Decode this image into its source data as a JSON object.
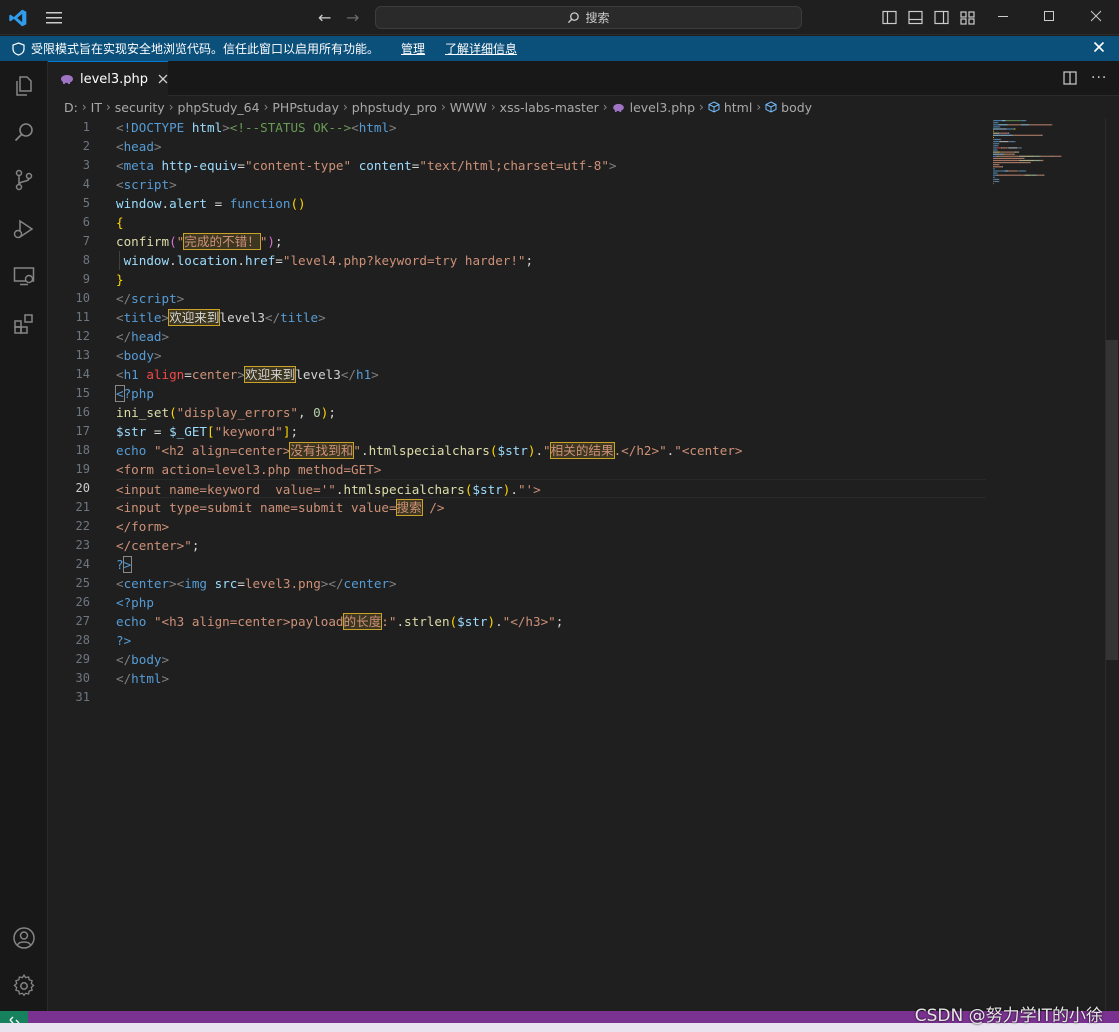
{
  "titlebar": {
    "search_placeholder": "搜索"
  },
  "banner": {
    "message": "受限模式旨在实现安全地浏览代码。信任此窗口以启用所有功能。",
    "manage_link": "管理",
    "learn_more_link": "了解详细信息"
  },
  "activity_bar": {
    "icons": [
      "explorer-icon",
      "search-icon",
      "source-control-icon",
      "run-debug-icon",
      "remote-explorer-icon",
      "extensions-icon",
      "accounts-icon",
      "settings-gear-icon"
    ]
  },
  "tabs": [
    {
      "label": "level3.php",
      "active": true
    }
  ],
  "breadcrumb": [
    "D:",
    "IT",
    "security",
    "phpStudy_64",
    "PHPstuday",
    "phpstudy_pro",
    "WWW",
    "xss-labs-master",
    "level3.php",
    "html",
    "body"
  ],
  "editor": {
    "active_line": 20,
    "line_numbers": [
      "1",
      "2",
      "3",
      "4",
      "5",
      "6",
      "7",
      "8",
      "9",
      "10",
      "11",
      "12",
      "13",
      "14",
      "15",
      "16",
      "17",
      "18",
      "19",
      "20",
      "21",
      "22",
      "23",
      "24",
      "25",
      "26",
      "27",
      "28",
      "29",
      "30",
      "31"
    ],
    "lines": [
      [
        [
          "t-punc",
          "<"
        ],
        [
          "t-tag",
          "!DOCTYPE "
        ],
        [
          "t-attr",
          "html"
        ],
        [
          "t-punc",
          ">"
        ],
        [
          "t-com",
          "<!--STATUS OK-->"
        ],
        [
          "t-punc",
          "<"
        ],
        [
          "t-tag",
          "html"
        ],
        [
          "t-punc",
          ">"
        ]
      ],
      [
        [
          "t-punc",
          "<"
        ],
        [
          "t-tag",
          "head"
        ],
        [
          "t-punc",
          ">"
        ]
      ],
      [
        [
          "t-punc",
          "<"
        ],
        [
          "t-tag",
          "meta "
        ],
        [
          "t-attr",
          "http-equiv"
        ],
        [
          "t-plain",
          "="
        ],
        [
          "t-str",
          "\"content-type\""
        ],
        [
          "t-plain",
          " "
        ],
        [
          "t-attr",
          "content"
        ],
        [
          "t-plain",
          "="
        ],
        [
          "t-str",
          "\"text/html;charset=utf-8\""
        ],
        [
          "t-punc",
          ">"
        ]
      ],
      [
        [
          "t-punc",
          "<"
        ],
        [
          "t-tag",
          "script"
        ],
        [
          "t-punc",
          ">"
        ]
      ],
      [
        [
          "t-var",
          "window"
        ],
        [
          "t-plain",
          "."
        ],
        [
          "t-var",
          "alert"
        ],
        [
          "t-plain",
          " = "
        ],
        [
          "t-key",
          "function"
        ],
        [
          "t-br1",
          "()"
        ]
      ],
      [
        [
          "t-br1",
          "{"
        ]
      ],
      [
        [
          "t-fn",
          "confirm"
        ],
        [
          "t-br2",
          "("
        ],
        [
          "t-str",
          "\""
        ],
        [
          "t-str hl",
          "完成的不错！"
        ],
        [
          "t-str",
          "\""
        ],
        [
          "t-br2",
          ")"
        ],
        [
          "t-plain",
          ";"
        ]
      ],
      [
        [
          "t-plain",
          " "
        ],
        [
          "t-var",
          "window"
        ],
        [
          "t-plain",
          "."
        ],
        [
          "t-var",
          "location"
        ],
        [
          "t-plain",
          "."
        ],
        [
          "t-var",
          "href"
        ],
        [
          "t-plain",
          "="
        ],
        [
          "t-str",
          "\"level4.php?keyword=try harder!\""
        ],
        [
          "t-plain",
          ";"
        ]
      ],
      [
        [
          "t-br1",
          "}"
        ]
      ],
      [
        [
          "t-punc",
          "</"
        ],
        [
          "t-tag",
          "script"
        ],
        [
          "t-punc",
          ">"
        ]
      ],
      [
        [
          "t-punc",
          "<"
        ],
        [
          "t-tag",
          "title"
        ],
        [
          "t-punc",
          ">"
        ],
        [
          "t-plain hl",
          "欢迎来到"
        ],
        [
          "t-plain",
          "level3"
        ],
        [
          "t-punc",
          "</"
        ],
        [
          "t-tag",
          "title"
        ],
        [
          "t-punc",
          ">"
        ]
      ],
      [
        [
          "t-punc",
          "</"
        ],
        [
          "t-tag",
          "head"
        ],
        [
          "t-punc",
          ">"
        ]
      ],
      [
        [
          "t-punc",
          "<"
        ],
        [
          "t-tag",
          "body"
        ],
        [
          "t-punc",
          ">"
        ]
      ],
      [
        [
          "t-punc",
          "<"
        ],
        [
          "t-tag",
          "h1 "
        ],
        [
          "t-red",
          "align"
        ],
        [
          "t-plain",
          "="
        ],
        [
          "t-str",
          "center"
        ],
        [
          "t-punc",
          ">"
        ],
        [
          "t-plain hl",
          "欢迎来到"
        ],
        [
          "t-plain",
          "level3"
        ],
        [
          "t-punc",
          "</"
        ],
        [
          "t-tag",
          "h1"
        ],
        [
          "t-punc",
          ">"
        ]
      ],
      [
        [
          "t-php bm",
          "<"
        ],
        [
          "t-php",
          "?php"
        ]
      ],
      [
        [
          "t-fn",
          "ini_set"
        ],
        [
          "t-br1",
          "("
        ],
        [
          "t-str",
          "\"display_errors\""
        ],
        [
          "t-plain",
          ", "
        ],
        [
          "t-num",
          "0"
        ],
        [
          "t-br1",
          ")"
        ],
        [
          "t-plain",
          ";"
        ]
      ],
      [
        [
          "t-var",
          "$str"
        ],
        [
          "t-plain",
          " = "
        ],
        [
          "t-var",
          "$_GET"
        ],
        [
          "t-br1",
          "["
        ],
        [
          "t-str",
          "\"keyword\""
        ],
        [
          "t-br1",
          "]"
        ],
        [
          "t-plain",
          ";"
        ]
      ],
      [
        [
          "t-key",
          "echo"
        ],
        [
          "t-plain",
          " "
        ],
        [
          "t-str",
          "\"<h2 align=center>"
        ],
        [
          "t-str hl",
          "没有找到和"
        ],
        [
          "t-str",
          "\""
        ],
        [
          "t-plain",
          "."
        ],
        [
          "t-fn",
          "htmlspecialchars"
        ],
        [
          "t-br1",
          "("
        ],
        [
          "t-var",
          "$str"
        ],
        [
          "t-br1",
          ")"
        ],
        [
          "t-plain",
          "."
        ],
        [
          "t-str",
          "\""
        ],
        [
          "t-str hl",
          "相关的结果"
        ],
        [
          "t-str",
          ".</h2>\""
        ],
        [
          "t-plain",
          "."
        ],
        [
          "t-str",
          "\"<center>"
        ]
      ],
      [
        [
          "t-str",
          "<form action=level3.php method=GET>"
        ]
      ],
      [
        [
          "t-str",
          "<input name=keyword  value='\""
        ],
        [
          "t-plain",
          "."
        ],
        [
          "t-fn",
          "htmlspecialchars"
        ],
        [
          "t-br1",
          "("
        ],
        [
          "t-var",
          "$str"
        ],
        [
          "t-br1",
          ")"
        ],
        [
          "t-plain",
          "."
        ],
        [
          "t-str",
          "\"'>"
        ]
      ],
      [
        [
          "t-str",
          "<input type=submit name=submit value="
        ],
        [
          "t-str hl",
          "搜索"
        ],
        [
          "t-str",
          " />"
        ]
      ],
      [
        [
          "t-str",
          "</form>"
        ]
      ],
      [
        [
          "t-str",
          "</center>\""
        ],
        [
          "t-plain",
          ";"
        ]
      ],
      [
        [
          "t-php",
          "?"
        ],
        [
          "t-php bm",
          ">"
        ]
      ],
      [
        [
          "t-punc",
          "<"
        ],
        [
          "t-tag",
          "center"
        ],
        [
          "t-punc",
          "><"
        ],
        [
          "t-tag",
          "img "
        ],
        [
          "t-attr",
          "src"
        ],
        [
          "t-plain",
          "="
        ],
        [
          "t-str",
          "level3.png"
        ],
        [
          "t-punc",
          "></"
        ],
        [
          "t-tag",
          "center"
        ],
        [
          "t-punc",
          ">"
        ]
      ],
      [
        [
          "t-php",
          "<?php"
        ]
      ],
      [
        [
          "t-key",
          "echo"
        ],
        [
          "t-plain",
          " "
        ],
        [
          "t-str",
          "\"<h3 align=center>payload"
        ],
        [
          "t-str hl",
          "的长度"
        ],
        [
          "t-str",
          ":\""
        ],
        [
          "t-plain",
          "."
        ],
        [
          "t-fn",
          "strlen"
        ],
        [
          "t-br1",
          "("
        ],
        [
          "t-var",
          "$str"
        ],
        [
          "t-br1",
          ")"
        ],
        [
          "t-plain",
          "."
        ],
        [
          "t-str",
          "\"</h3>\""
        ],
        [
          "t-plain",
          ";"
        ]
      ],
      [
        [
          "t-php",
          "?>"
        ]
      ],
      [
        [
          "t-punc",
          "</"
        ],
        [
          "t-tag",
          "body"
        ],
        [
          "t-punc",
          ">"
        ]
      ],
      [
        [
          "t-punc",
          "</"
        ],
        [
          "t-tag",
          "html"
        ],
        [
          "t-punc",
          ">"
        ]
      ],
      [
        [
          "t-plain",
          ""
        ]
      ]
    ]
  },
  "watermark": "CSDN @努力学IT的小徐",
  "colors": {
    "banner_bg": "#0b4f7b",
    "statusbar_bg": "#7a3290",
    "tab_accent": "#0078d4",
    "highlight_border": "#c9a227"
  }
}
